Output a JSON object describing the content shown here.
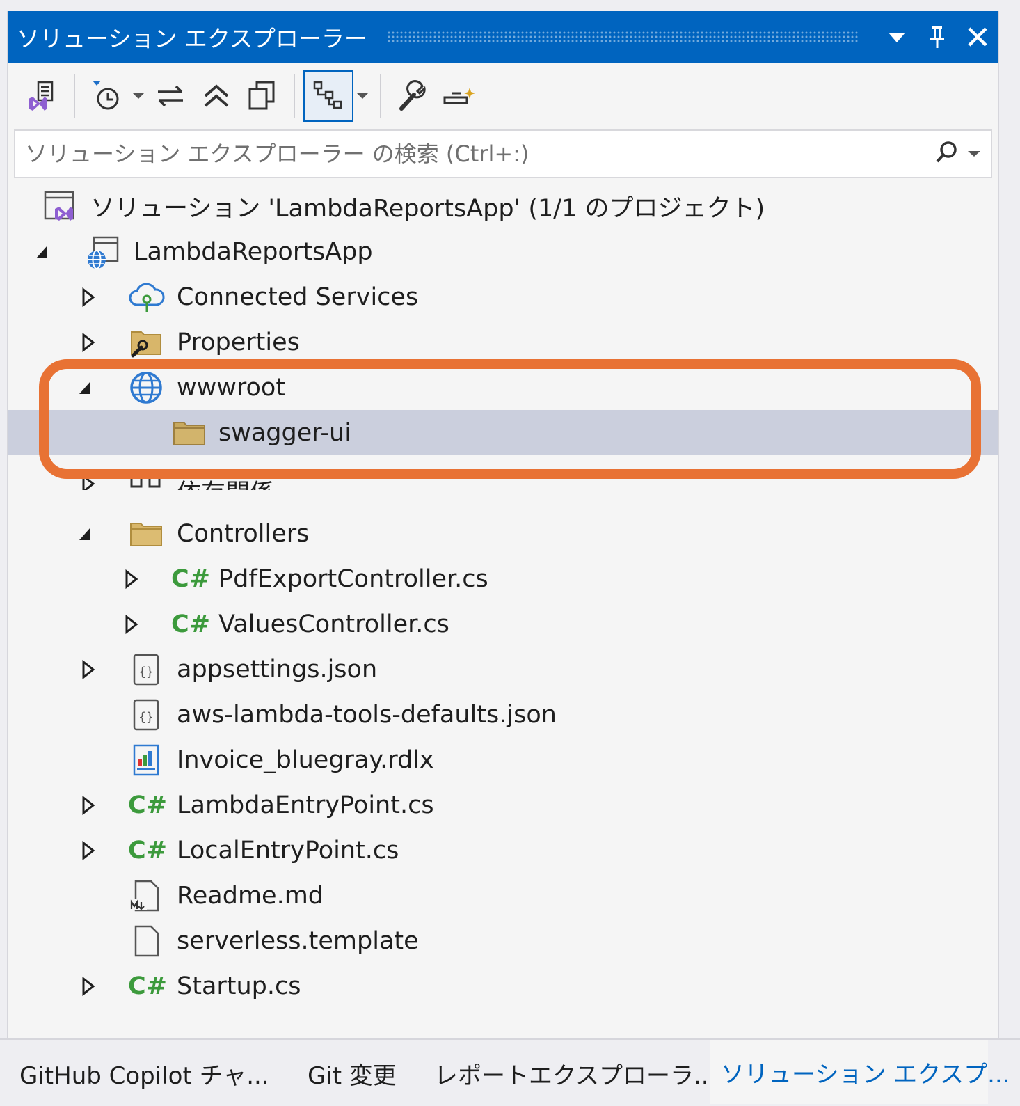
{
  "window": {
    "title": "ソリューション エクスプローラー"
  },
  "search": {
    "placeholder": "ソリューション エクスプローラー の検索 (Ctrl+:)"
  },
  "tree": {
    "solution": "ソリューション 'LambdaReportsApp' (1/1 のプロジェクト)",
    "project": "LambdaReportsApp",
    "connected_services": "Connected Services",
    "properties": "Properties",
    "wwwroot": "wwwroot",
    "swagger_ui": "swagger-ui",
    "dependencies": "依存関係",
    "controllers": "Controllers",
    "pdf_export_controller": "PdfExportController.cs",
    "values_controller": "ValuesController.cs",
    "appsettings": "appsettings.json",
    "aws_lambda_defaults": "aws-lambda-tools-defaults.json",
    "invoice_report": "Invoice_bluegray.rdlx",
    "lambda_entry_point": "LambdaEntryPoint.cs",
    "local_entry_point": "LocalEntryPoint.cs",
    "readme": "Readme.md",
    "serverless_template": "serverless.template",
    "startup": "Startup.cs",
    "csharp_badge": "C#"
  },
  "bottom_tabs": {
    "copilot": "GitHub Copilot チャ...",
    "git": "Git 変更",
    "report_explorer": "レポートエクスプローラ...",
    "solution_explorer": "ソリューション エクスプ..."
  },
  "colors": {
    "title_bar": "#0064bf",
    "highlight": "#e87234",
    "selected_row": "#cbcfdd",
    "csharp": "#3c9a3c",
    "folder": "#c8a95e"
  }
}
